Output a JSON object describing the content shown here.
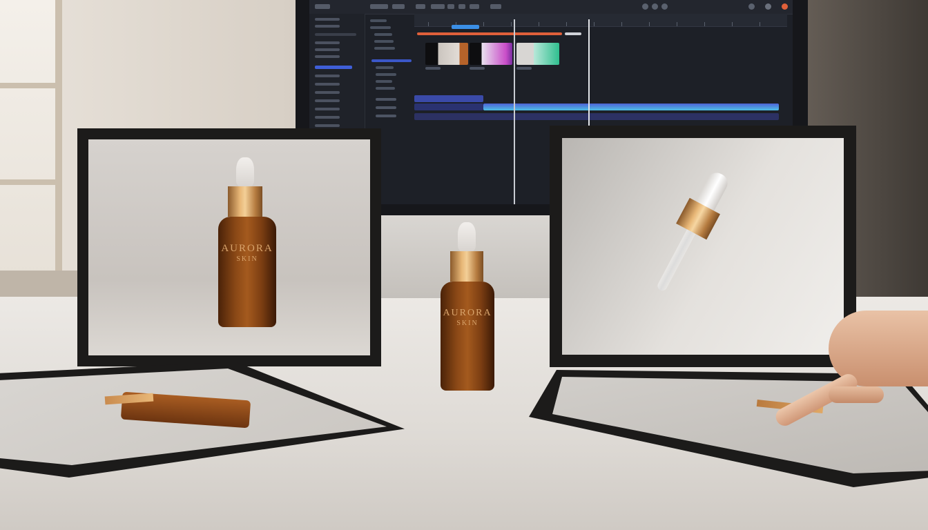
{
  "scene": {
    "description_free": true,
    "colors": {
      "amber": "#8a4816",
      "gold_collar": "#e8b777",
      "editor_blue": "#3f5fd8",
      "editor_cyan": "#4ec0e6",
      "editor_orange": "#e0603a"
    }
  },
  "product": {
    "brand_line1": "AURORA",
    "brand_line2": "SKIN"
  },
  "editor": {
    "window_controls": [
      "minimize-icon",
      "maximize-icon",
      "close-icon"
    ],
    "timeline_tracks": 3
  }
}
